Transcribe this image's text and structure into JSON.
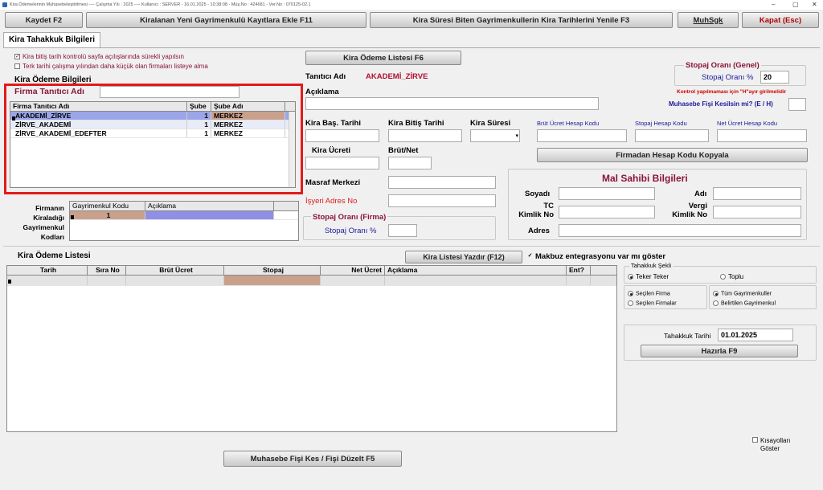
{
  "window": {
    "title": "Kira Ödemelerinin Muhasebeleştirilmesi ---- Çalışma Yılı : 2025 ---- Kullanıcı : SERVER - 16.01.2025 - 10:38:08 - Müş.No : 424681 - Ver.No : 070125-02.1"
  },
  "toolbar": {
    "save": "Kaydet F2",
    "add_rented": "Kiralanan Yeni Gayrimenkulü Kayıtlara Ekle F11",
    "renew": "Kira Süresi Biten Gayrimenkullerin Kira Tarihlerini Yenile F3",
    "muhsgk": "MuhSgk",
    "close": "Kapat (Esc)"
  },
  "tab": {
    "label": "Kira Tahakkuk Bilgileri"
  },
  "options": {
    "check1": "Kira bitiş tarih kontrolü sayfa açılışlarında sürekli yapılsın",
    "check2": "Terk tarihi çalışma yılından daha küçük olan firmaları listeye alma"
  },
  "kira_odeme": {
    "title": "Kira Ödeme Bilgileri",
    "firma_label": "Firma Tanıtıcı Adı",
    "columns": [
      "Firma Tanıtıcı Adı",
      "Şube",
      "Şube Adı"
    ],
    "rows": [
      [
        "AKADEMİ_ZİRVE",
        "1",
        "MERKEZ"
      ],
      [
        "ZİRVE_AKADEMİ",
        "1",
        "MERKEZ"
      ],
      [
        "ZİRVE_AKADEMİ_EDEFTER",
        "1",
        "MERKEZ"
      ]
    ]
  },
  "gayrimenkul": {
    "label_lines": [
      "Firmanın",
      "Kiraladığı",
      "Gayrimenkul",
      "Kodları"
    ],
    "columns": [
      "Gayrimenkul Kodu",
      "Açıklama"
    ],
    "rows": [
      [
        "1",
        ""
      ]
    ]
  },
  "form": {
    "list_button": "Kira Ödeme Listesi F6",
    "tanitici_label": "Tanıtıcı Adı",
    "tanitici_value": "AKADEMİ_ZİRVE",
    "aciklama_label": "Açıklama",
    "bas_tarihi": "Kira Baş. Tarihi",
    "bitis_tarihi": "Kira Bitiş Tarihi",
    "kira_suresi": "Kira Süresi",
    "brut_hesap": "Brüt Ücret Hesap Kodu",
    "stopaj_hesap": "Stopaj Hesap Kodu",
    "net_hesap": "Net Ücret Hesap Kodu",
    "kira_ucreti": "Kira Ücreti",
    "brut_net": "Brüt/Net",
    "copy_button": "Firmadan Hesap Kodu Kopyala",
    "masraf": "Masraf Merkezi",
    "isyeri": "İşyeri Adres No",
    "stopaj_firma_title": "Stopaj Oranı (Firma)",
    "stopaj_firma_label": "Stopaj Oranı %"
  },
  "stopaj_genel": {
    "title": "Stopaj Oranı (Genel)",
    "label": "Stopaj Oranı %",
    "value": "20",
    "note": "Kontrol yapılmaması için \"H\"ayır girilmelidir",
    "fis_label": "Muhasebe Fişi Kesilsin mi? (E / H)"
  },
  "mal_sahibi": {
    "title": "Mal Sahibi Bilgileri",
    "soyadi": "Soyadı",
    "adi": "Adı",
    "tc1": "TC",
    "tc2": "Kimlik No",
    "vergi1": "Vergi",
    "vergi2": "Kimlik No",
    "adres": "Adres"
  },
  "liste": {
    "title": "Kira Ödeme Listesi",
    "print_button": "Kira Listesi Yazdır (F12)",
    "makbuz": "Makbuz entegrasyonu var mı göster",
    "columns": [
      "Tarih",
      "Sıra No",
      "Brüt Ücret",
      "Stopaj",
      "Net Ücret",
      "Açıklama",
      "Ent?"
    ]
  },
  "tahakkuk": {
    "sekli_title": "Tahakkuk Şekli",
    "teker": "Teker Teker",
    "toplu": "Toplu",
    "secilen_firma": "Seçilen Firma",
    "secilen_firmalar": "Seçilen Firmalar",
    "tum_gay": "Tüm Gayrimenkuller",
    "belirtilen_gay": "Belirtilen Gayrimenkul",
    "tarih_label": "Tahakkuk Tarihi",
    "tarih_value": "01.01.2025",
    "hazirla": "Hazırla F9"
  },
  "footer": {
    "fis_button": "Muhasebe Fişi Kes / Fişi Düzelt F5",
    "kisayol1": "Kısayolları",
    "kisayol2": "Göster"
  },
  "colors": {
    "highlight_red": "#e01b1b",
    "selected_row": "#9aa6e8",
    "tan_cell": "#c9a08c",
    "purple_cell": "#8f8fe6",
    "maroon_text": "#8a1538",
    "blue_text": "#1a1a9a"
  }
}
